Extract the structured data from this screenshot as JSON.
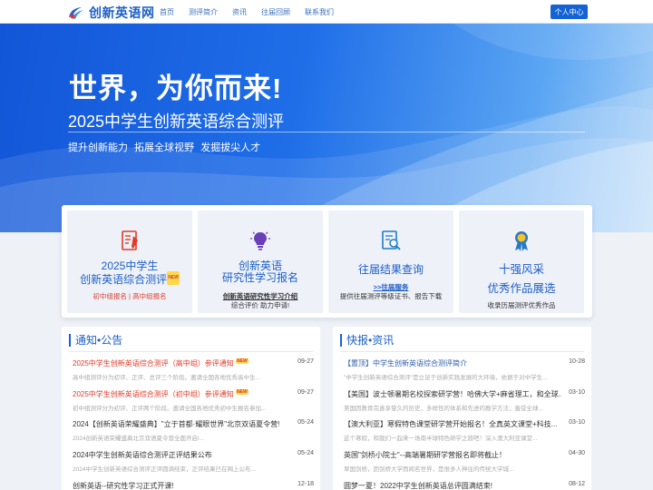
{
  "header": {
    "logo_text": "创新英语网",
    "nav": [
      "首页",
      "测评简介",
      "资讯",
      "往届回顾",
      "联系我们"
    ],
    "user_button": "个人中心"
  },
  "banner": {
    "title": "世界，为你而来!",
    "subtitle": "2025中学生创新英语综合测评",
    "tagline": "提升创新能力  拓展全球视野  发掘拔尖人才"
  },
  "cards": [
    {
      "title_line1": "2025中学生",
      "title_line2": "创新英语综合测评",
      "badge": "NEW",
      "link1": "初中组报名",
      "separator": "|",
      "link2": "高中组报名"
    },
    {
      "title_line1": "创新英语",
      "title_line2": "研究性学习报名",
      "sub1": "创新英语研究性学习介绍",
      "sub2": "综合评价  助力申请!"
    },
    {
      "title_line1": "往届结果查询",
      "sub1": ">>往届服务",
      "sub2": "提供往届测评等级证书、报告下载"
    },
    {
      "title_line1": "十强风采",
      "title_line2": "优秀作品展选",
      "sub1": "收录历届测评优秀作品"
    }
  ],
  "notice": {
    "title": "通知•公告",
    "items": [
      {
        "title": "2025中学生创新英语综合测评（高中组）参评通知",
        "date": "09-27",
        "summary": "高中组测评分为初评、正评、总评三个阶段。邀请全国各地优秀高中生...",
        "badge": "NEW",
        "style": "red"
      },
      {
        "title": "2025中学生创新英语综合测评（初中组）参评通知",
        "date": "09-27",
        "summary": "初中组测评分为初评、正评两个阶段。邀请全国各地优秀初中生报名参加...",
        "badge": "NEW",
        "style": "red"
      },
      {
        "title": "2024【创新英语荣耀盛典】\"立于首都·耀眼世界\"北京双语夏令营!",
        "date": "05-24",
        "summary": "2024创新英语荣耀盛典北京双语夏令营全面开启!...",
        "style": "normal"
      },
      {
        "title": "2024中学生创新英语综合测评正评结果公布",
        "date": "05-24",
        "summary": "2024中学生创新英语综合测评正评圆满结束，正评结果已在网上公布...",
        "style": "normal"
      },
      {
        "title": "创新英语--研究性学习正式开课!",
        "date": "12-18",
        "summary": "",
        "style": "normal"
      }
    ]
  },
  "news": {
    "title": "快报•资讯",
    "items": [
      {
        "title": "【置顶】中学生创新英语综合测评简介",
        "date": "10-28",
        "summary": "\"中学生创新英语综合测评\"是立足于创新实践发展的大环境，依据于对中学生...",
        "style": "blue"
      },
      {
        "title": "【美国】波士顿暑期名校探索研学营！哈佛大学+麻省理工，和全球...",
        "date": "03-10",
        "summary": "美国因教育完善享誉久的历史，多样性的体系和先进的教学方法，备受全球...",
        "style": "normal"
      },
      {
        "title": "【澳大利亚】寒假特色课堂研学营开始报名！全真英文课堂+科技...",
        "date": "03-10",
        "summary": "这个寒假，和我们一起来一场南半球特色研学之旅吧！深入澳大利亚课堂...",
        "style": "normal"
      },
      {
        "title": "英国\"剑桥小院士\"--高端暑期研学营报名即将截止！",
        "date": "04-30",
        "summary": "翠国剑桥，因剑桥大学而闻名世界，是很多人神往的传统大学城...",
        "style": "normal"
      },
      {
        "title": "圆梦一夏！2022中学生创新英语总评圆满结束!",
        "date": "08-12",
        "summary": "",
        "style": "normal"
      }
    ]
  },
  "colors": {
    "brand": "#1463d6",
    "accent_red": "#e03a28",
    "card_bg": "#eef1f8"
  }
}
